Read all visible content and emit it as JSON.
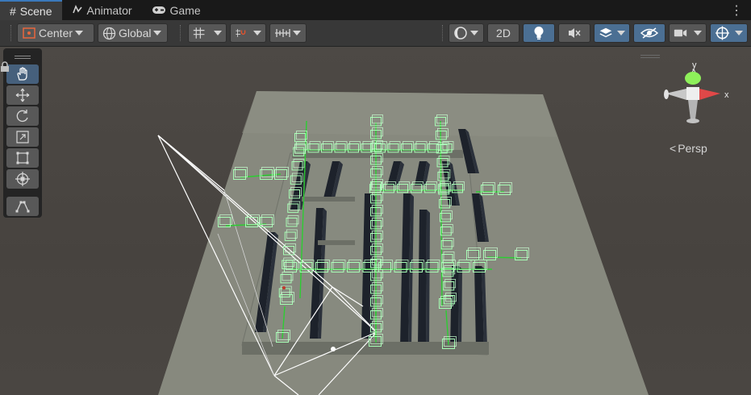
{
  "tabs": [
    {
      "label": "Scene",
      "icon": "grid-hash-icon"
    },
    {
      "label": "Animator",
      "icon": "animator-icon"
    },
    {
      "label": "Game",
      "icon": "gamepad-icon"
    }
  ],
  "tab_menu": "⋮",
  "toolbar": {
    "pivot_label": "Center",
    "space_label": "Global",
    "mode_2d_label": "2D"
  },
  "view": {
    "projection_label": "Persp",
    "gizmo_axis_x": "x",
    "gizmo_axis_y": "y"
  },
  "tools": [
    {
      "name": "hand-tool",
      "icon": "hand-icon",
      "active": true
    },
    {
      "name": "move-tool",
      "icon": "move-arrows-icon",
      "active": false
    },
    {
      "name": "rotate-tool",
      "icon": "rotate-icon",
      "active": false
    },
    {
      "name": "scale-tool",
      "icon": "scale-icon",
      "active": false
    },
    {
      "name": "rect-tool",
      "icon": "rect-transform-icon",
      "active": false
    },
    {
      "name": "transform-tool",
      "icon": "transform-icon",
      "active": false
    },
    {
      "name": "custom-tool",
      "icon": "custom-editor-tool-icon",
      "active": false
    }
  ],
  "colors": {
    "accent": "#3a79bb",
    "active_button": "#4b6f93",
    "wire_green": "#9dffb0",
    "link_green": "#2ccd32",
    "ground": "#8a8c80"
  }
}
